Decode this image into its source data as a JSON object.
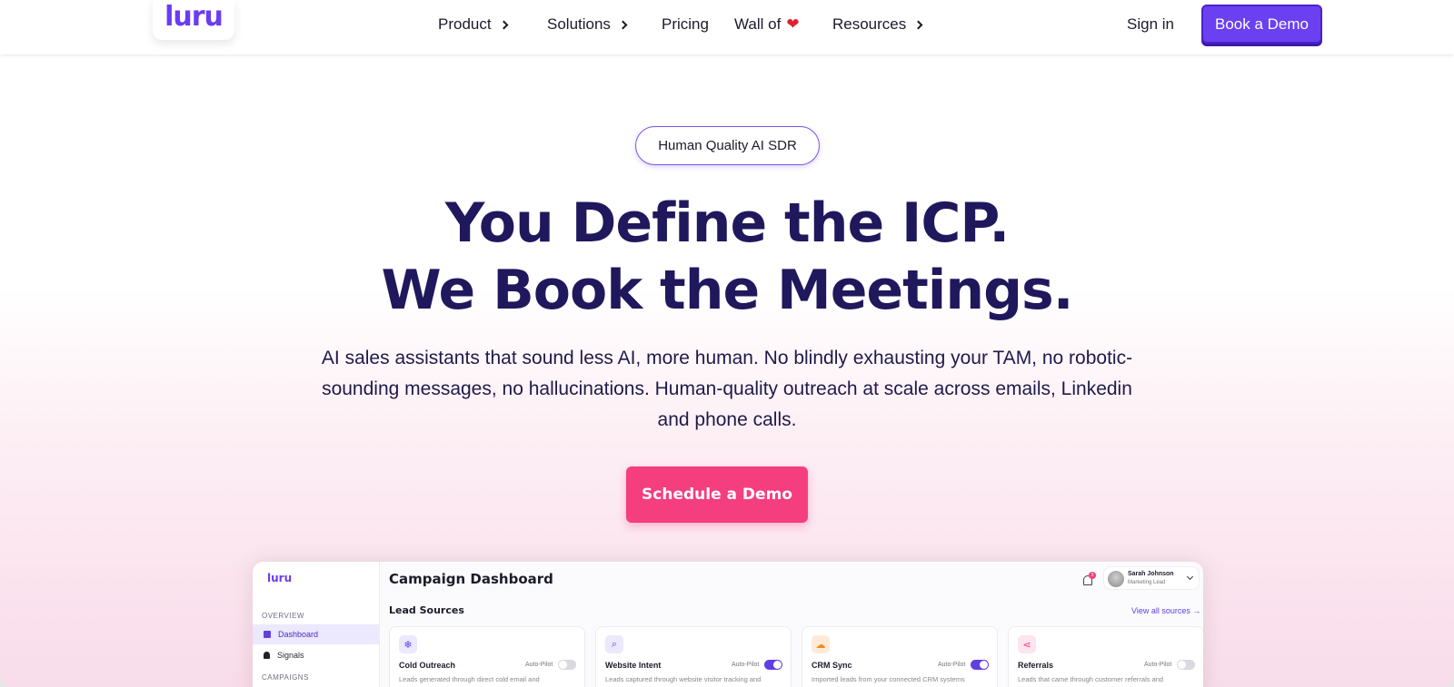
{
  "nav": {
    "logo": "luru",
    "items": [
      {
        "label": "Product",
        "has_chevron": true
      },
      {
        "label": "Solutions",
        "has_chevron": true
      },
      {
        "label": "Pricing",
        "has_chevron": false
      },
      {
        "label": "Wall of",
        "suffix_icon": "heart-icon"
      },
      {
        "label": "Resources",
        "has_chevron": true
      }
    ],
    "signin": "Sign in",
    "book_demo": "Book a Demo"
  },
  "hero": {
    "pill": "Human Quality AI SDR",
    "headline_1": "You Define the ICP.",
    "headline_2": "We Book the Meetings.",
    "subtext": "AI sales assistants that sound less AI, more human. No blindly exhausting your TAM, no robotic-sounding messages, no hallucinations. Human-quality  outreach at scale across emails, Linkedin and phone calls.",
    "cta": "Schedule a Demo"
  },
  "colors": {
    "accent": "#6a40f0",
    "cta": "#f53e7e",
    "headline": "#20185c"
  },
  "dashboard": {
    "logo": "luru",
    "title": "Campaign Dashboard",
    "sidebar": {
      "overview_heading": "OVERVIEW",
      "items": [
        {
          "label": "Dashboard",
          "icon": "grid-icon",
          "active": true
        },
        {
          "label": "Signals",
          "icon": "bell-icon",
          "active": false
        }
      ],
      "campaigns_heading": "CAMPAIGNS"
    },
    "notification_count": "3",
    "user": {
      "name": "Sarah Johnson",
      "role": "Marketing Lead"
    },
    "lead_sources_heading": "Lead Sources",
    "view_all": "View all sources →",
    "cards": [
      {
        "name": "Cold Outreach",
        "icon": "snowflake-icon",
        "autopilot_label": "Auto-Pilot",
        "autopilot_on": false,
        "desc": "Leads generated through direct cold email and"
      },
      {
        "name": "Website Intent",
        "icon": "search-icon",
        "autopilot_label": "Auto-Pilot",
        "autopilot_on": true,
        "desc": "Leads captured through website visitor tracking and"
      },
      {
        "name": "CRM Sync",
        "icon": "cloud-icon",
        "autopilot_label": "Auto-Pilot",
        "autopilot_on": true,
        "desc": "Imported leads from your connected CRM systems"
      },
      {
        "name": "Referrals",
        "icon": "share-icon",
        "autopilot_label": "Auto-Pilot",
        "autopilot_on": false,
        "desc": "Leads that came through customer referrals and"
      }
    ]
  }
}
